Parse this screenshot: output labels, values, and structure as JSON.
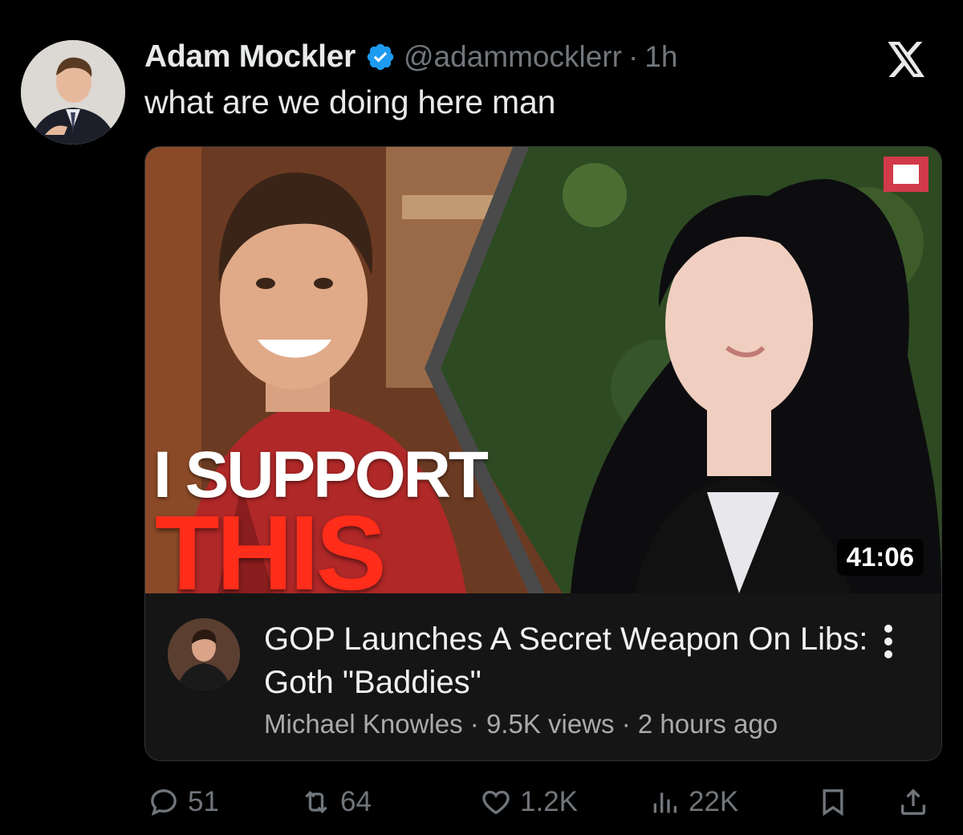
{
  "tweet": {
    "author_name": "Adam Mockler",
    "handle": "@adammocklerr",
    "separator": "·",
    "time": "1h",
    "text": "what are we doing here man"
  },
  "card": {
    "thumbnail_text_line1": "I SUPPORT",
    "thumbnail_text_line2": "THIS",
    "duration": "41:06",
    "video_title": "GOP Launches A Secret Weapon On Libs: Goth \"Baddies\"",
    "channel": "Michael Knowles",
    "views": "9.5K views",
    "posted": "2 hours ago",
    "meta_separator": " · "
  },
  "actions": {
    "replies": "51",
    "retweets": "64",
    "likes": "1.2K",
    "views": "22K"
  },
  "icons": {
    "verified": "verified-badge-icon",
    "x_logo": "x-logo-icon",
    "reply": "reply-icon",
    "retweet": "retweet-icon",
    "like": "heart-icon",
    "views": "views-chart-icon",
    "bookmark": "bookmark-icon",
    "share": "share-icon",
    "more": "more-vertical-icon"
  },
  "colors": {
    "background": "#000000",
    "text_primary": "#e7e9ea",
    "text_secondary": "#71767b",
    "verified_blue": "#1d9bf0",
    "accent_red": "#ff2d1a"
  }
}
